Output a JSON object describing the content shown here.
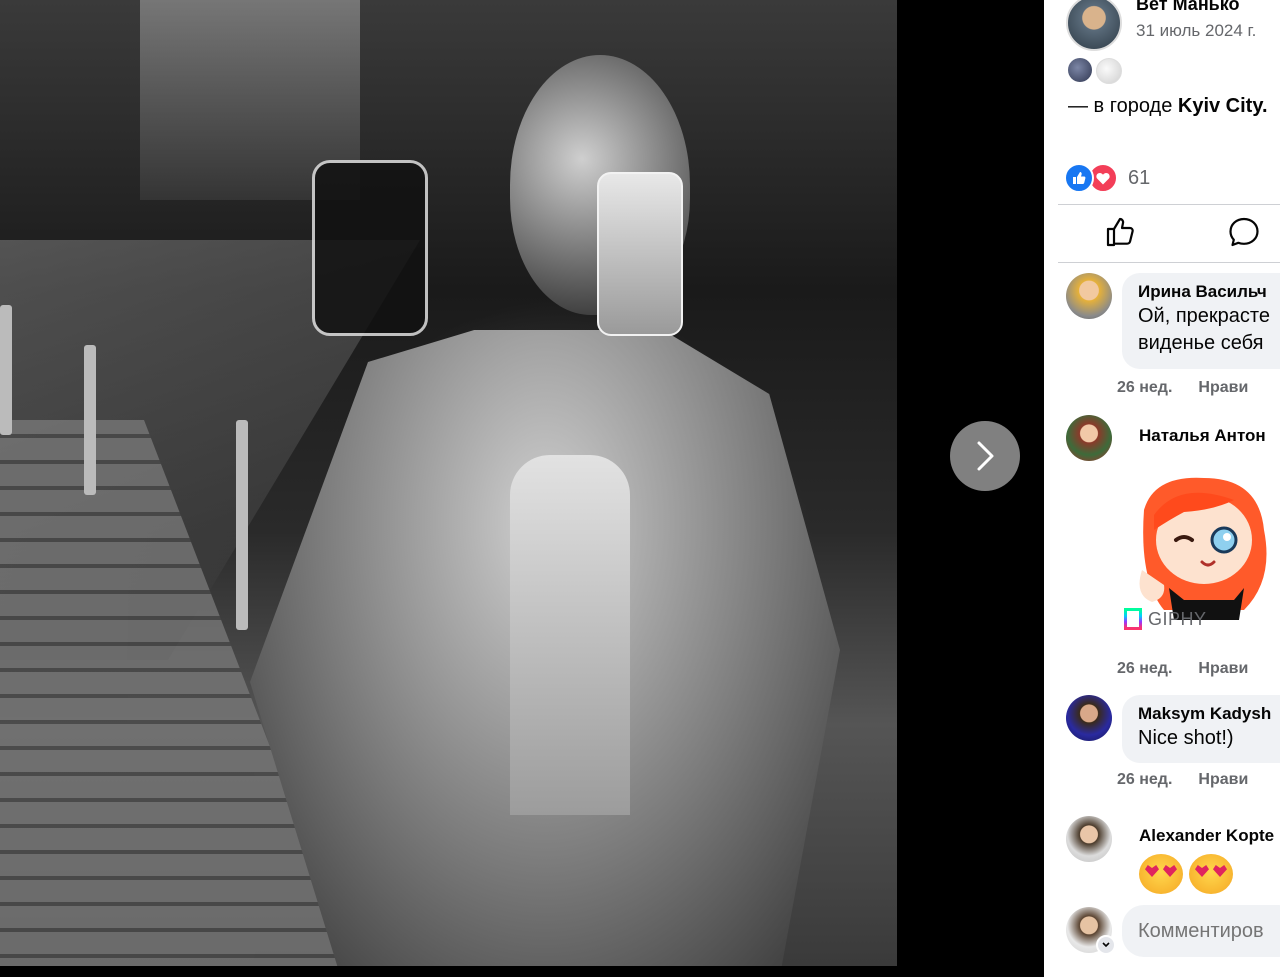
{
  "post": {
    "author": "Вет Манько",
    "date": "31 июль 2024 г.",
    "location_prefix": "— в городе ",
    "location_name": "Kyiv City."
  },
  "reactions": {
    "count": "61",
    "types": [
      "like-icon",
      "love-icon"
    ]
  },
  "actions": {
    "like_icon": "thumbs-up-icon",
    "comment_icon": "comment-bubble-icon"
  },
  "comments": [
    {
      "name": "Ирина Васильч",
      "text": "Ой, прекрасте\nвиденье себя",
      "time": "26 нед.",
      "like": "Нрави"
    },
    {
      "name": "Наталья Антон",
      "text": "",
      "sticker_source": "GIPHY",
      "time": "26 нед.",
      "like": "Нрави"
    },
    {
      "name": "Maksym Kadysh",
      "text": "Nice shot!)",
      "time": "26 нед.",
      "like": "Нрави"
    },
    {
      "name": "Alexander Kopte",
      "text": "",
      "emoji": [
        "heart-eyes",
        "heart-eyes"
      ]
    }
  ],
  "comment_input": {
    "placeholder": "Комментиров"
  },
  "colors": {
    "like_blue": "#1877f2",
    "love_red": "#f33e58",
    "meta_gray": "#65676b",
    "bubble_bg": "#f0f2f5"
  }
}
